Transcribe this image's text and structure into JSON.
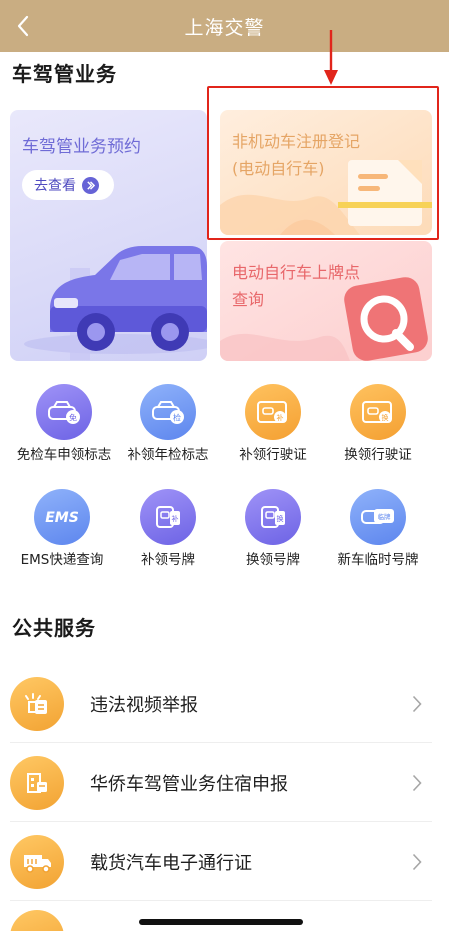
{
  "header": {
    "title": "上海交警",
    "back_icon": "chevron-left-icon"
  },
  "section1": {
    "title": "车驾管业务"
  },
  "cards": {
    "appointment": {
      "title": "车驾管业务预约",
      "button_label": "去查看"
    },
    "registration": {
      "line1": "非机动车注册登记",
      "line2": "(电动自行车)"
    },
    "plate_query": {
      "line1": "电动自行车上牌点",
      "line2": "查询"
    }
  },
  "grid": [
    {
      "label": "免检车申领标志",
      "icon": "car-exempt-icon",
      "badge": "免",
      "color": "purple"
    },
    {
      "label": "补领年检标志",
      "icon": "car-inspection-icon",
      "badge": "检",
      "color": "blue"
    },
    {
      "label": "补领行驶证",
      "icon": "license-card-icon",
      "badge": "补",
      "color": "orange"
    },
    {
      "label": "换领行驶证",
      "icon": "license-card-exchange-icon",
      "badge": "换",
      "color": "orange"
    },
    {
      "label": "EMS快递查询",
      "icon": "ems-icon",
      "badge": "EMS",
      "color": "blue"
    },
    {
      "label": "补领号牌",
      "icon": "plate-reissue-icon",
      "badge": "补",
      "color": "purple"
    },
    {
      "label": "换领号牌",
      "icon": "plate-exchange-icon",
      "badge": "换",
      "color": "purple"
    },
    {
      "label": "新车临时号牌",
      "icon": "temp-plate-icon",
      "badge": "临牌",
      "color": "blue"
    }
  ],
  "section2": {
    "title": "公共服务"
  },
  "services": [
    {
      "label": "违法视频举报",
      "icon": "report-video-icon"
    },
    {
      "label": "华侨车驾管业务住宿申报",
      "icon": "building-icon"
    },
    {
      "label": "载货汽车电子通行证",
      "icon": "truck-icon"
    }
  ],
  "colors": {
    "header": "#c9ad82",
    "annotation": "#e1251b",
    "purple": "#6d63e5",
    "orange": "#f4a032",
    "blue": "#5d86ee"
  }
}
